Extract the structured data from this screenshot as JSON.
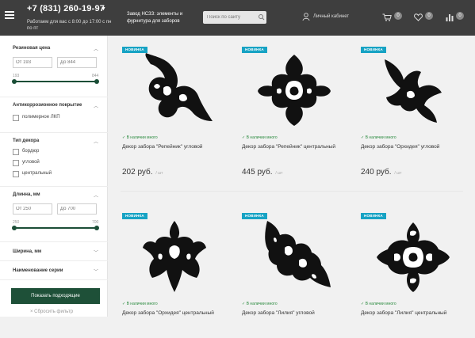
{
  "header": {
    "phone": "+7 (831) 260-19-97",
    "hours": "Работаем для вас с 8:00 до 17:00 с пн по пт",
    "tagline": "Завод НСЗЗ: элементы и фурнитура для заборов",
    "search_placeholder": "Поиск по сайту",
    "account_label": "Личный кабинет",
    "cart_count": "0",
    "wishlist_count": "0",
    "compare_count": "0"
  },
  "filters": {
    "rubber_price": {
      "title": "Резиновая цена",
      "from_placeholder": "От 193",
      "to_placeholder": "До 844",
      "min_label": "193",
      "max_label": "844",
      "range": [
        193,
        844
      ]
    },
    "anticorrosion": {
      "title": "Антикоррозионное покрытие",
      "options": [
        "полимерное ЛКП"
      ]
    },
    "decor_type": {
      "title": "Тип декора",
      "options": [
        "бордюр",
        "угловой",
        "центральный"
      ]
    },
    "length": {
      "title": "Длинна, мм",
      "from_placeholder": "От 250",
      "to_placeholder": "До 700",
      "min_label": "250",
      "max_label": "700",
      "range": [
        250,
        700
      ]
    },
    "width": {
      "title": "Ширина, мм"
    },
    "series": {
      "title": "Наименование серии"
    },
    "apply_label": "Показать подходящие",
    "reset_label": "× Сбросить фильтр"
  },
  "products": [
    {
      "tag": "НОВИНКА",
      "stock": "✓ В наличии много",
      "name": "Декор забора \"Репейник\" угловой",
      "price": "202 руб.",
      "unit": "/ шт",
      "shape": "corner-leaf"
    },
    {
      "tag": "НОВИНКА",
      "stock": "✓ В наличии много",
      "name": "Декор забора \"Репейник\" центральный",
      "price": "445 руб.",
      "unit": "/ шт",
      "shape": "center-ornament"
    },
    {
      "tag": "НОВИНКА",
      "stock": "✓ В наличии много",
      "name": "Декор забора \"Орхидея\" угловой",
      "price": "240 руб.",
      "unit": "/ шт",
      "shape": "corner-lily"
    },
    {
      "tag": "НОВИНКА",
      "stock": "✓ В наличии много",
      "name": "Декор забора \"Орхидея\" центральный",
      "price": "",
      "unit": "",
      "shape": "fleur"
    },
    {
      "tag": "НОВИНКА",
      "stock": "✓ В наличии много",
      "name": "Декор забора \"Лилия\" угловой",
      "price": "",
      "unit": "",
      "shape": "corner-scroll"
    },
    {
      "tag": "НОВИНКА",
      "stock": "✓ В наличии много",
      "name": "Декор забора \"Лилия\" центральный",
      "price": "",
      "unit": "",
      "shape": "knot"
    }
  ],
  "colors": {
    "header_bg": "#3e3e3e",
    "accent_green": "#1e5038",
    "tag_blue": "#17a3c4",
    "in_stock": "#2a8a3e"
  }
}
